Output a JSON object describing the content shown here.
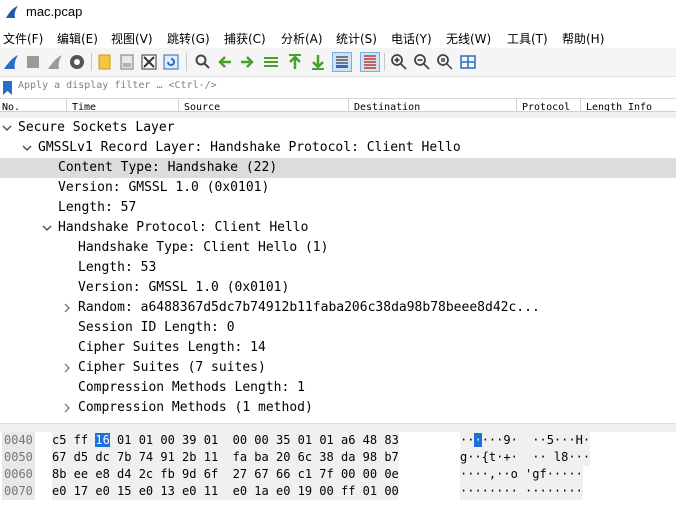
{
  "window": {
    "title": "mac.pcap"
  },
  "menu": [
    "文件(F)",
    "编辑(E)",
    "视图(V)",
    "跳转(G)",
    "捕获(C)",
    "分析(A)",
    "统计(S)",
    "电话(Y)",
    "无线(W)",
    "工具(T)",
    "帮助(H)"
  ],
  "filter": {
    "placeholder": "Apply a display filter … <Ctrl-/>"
  },
  "columns": [
    "No.",
    "Time",
    "Source",
    "Destination",
    "Protocol",
    "Length",
    "Info"
  ],
  "tree": [
    {
      "text": "Secure Sockets Layer",
      "level": 0,
      "arrow": "down"
    },
    {
      "text": "GMSSLv1 Record Layer: Handshake Protocol: Client Hello",
      "level": 1,
      "arrow": "down"
    },
    {
      "text": "Content Type: Handshake (22)",
      "level": 2,
      "arrow": "none",
      "selected": true
    },
    {
      "text": "Version: GMSSL 1.0 (0x0101)",
      "level": 2,
      "arrow": "none"
    },
    {
      "text": "Length: 57",
      "level": 2,
      "arrow": "none"
    },
    {
      "text": "Handshake Protocol: Client Hello",
      "level": 2,
      "arrow": "down"
    },
    {
      "text": "Handshake Type: Client Hello (1)",
      "level": 3,
      "arrow": "none"
    },
    {
      "text": "Length: 53",
      "level": 3,
      "arrow": "none"
    },
    {
      "text": "Version: GMSSL 1.0 (0x0101)",
      "level": 3,
      "arrow": "none"
    },
    {
      "text": "Random: a6488367d5dc7b74912b11faba206c38da98b78beee8d42c...",
      "level": 3,
      "arrow": "right"
    },
    {
      "text": "Session ID Length: 0",
      "level": 3,
      "arrow": "none"
    },
    {
      "text": "Cipher Suites Length: 14",
      "level": 3,
      "arrow": "none"
    },
    {
      "text": "Cipher Suites (7 suites)",
      "level": 3,
      "arrow": "right"
    },
    {
      "text": "Compression Methods Length: 1",
      "level": 3,
      "arrow": "none"
    },
    {
      "text": "Compression Methods (1 method)",
      "level": 3,
      "arrow": "right"
    }
  ],
  "hex": [
    {
      "offset": "0040",
      "pre": "c5 ff ",
      "hi": "16",
      "post": " 01 01 00 39 01  00 00 35 01 01 a6 48 83",
      "ascii_pre": "··",
      "ascii_hi": "·",
      "ascii_post": "···9·  ··5···H·"
    },
    {
      "offset": "0050",
      "pre": "67 d5 dc 7b 74 91 2b 11  fa ba 20 6c 38 da 98 b7",
      "hi": "",
      "post": "",
      "ascii_pre": "g··{t·+·  ·· l8···",
      "ascii_hi": "",
      "ascii_post": ""
    },
    {
      "offset": "0060",
      "pre": "8b ee e8 d4 2c fb 9d 6f  27 67 66 c1 7f 00 00 0e",
      "hi": "",
      "post": "",
      "ascii_pre": "····,··o 'gf·····",
      "ascii_hi": "",
      "ascii_post": ""
    },
    {
      "offset": "0070",
      "pre": "e0 17 e0 15 e0 13 e0 11  e0 1a e0 19 00 ff 01 00",
      "hi": "",
      "post": "",
      "ascii_pre": "········ ········",
      "ascii_hi": "",
      "ascii_post": ""
    }
  ],
  "colors": {
    "selection": "#dcdcdc",
    "hex_highlight": "#1e6fd9",
    "accent": "#1e6fd9"
  }
}
